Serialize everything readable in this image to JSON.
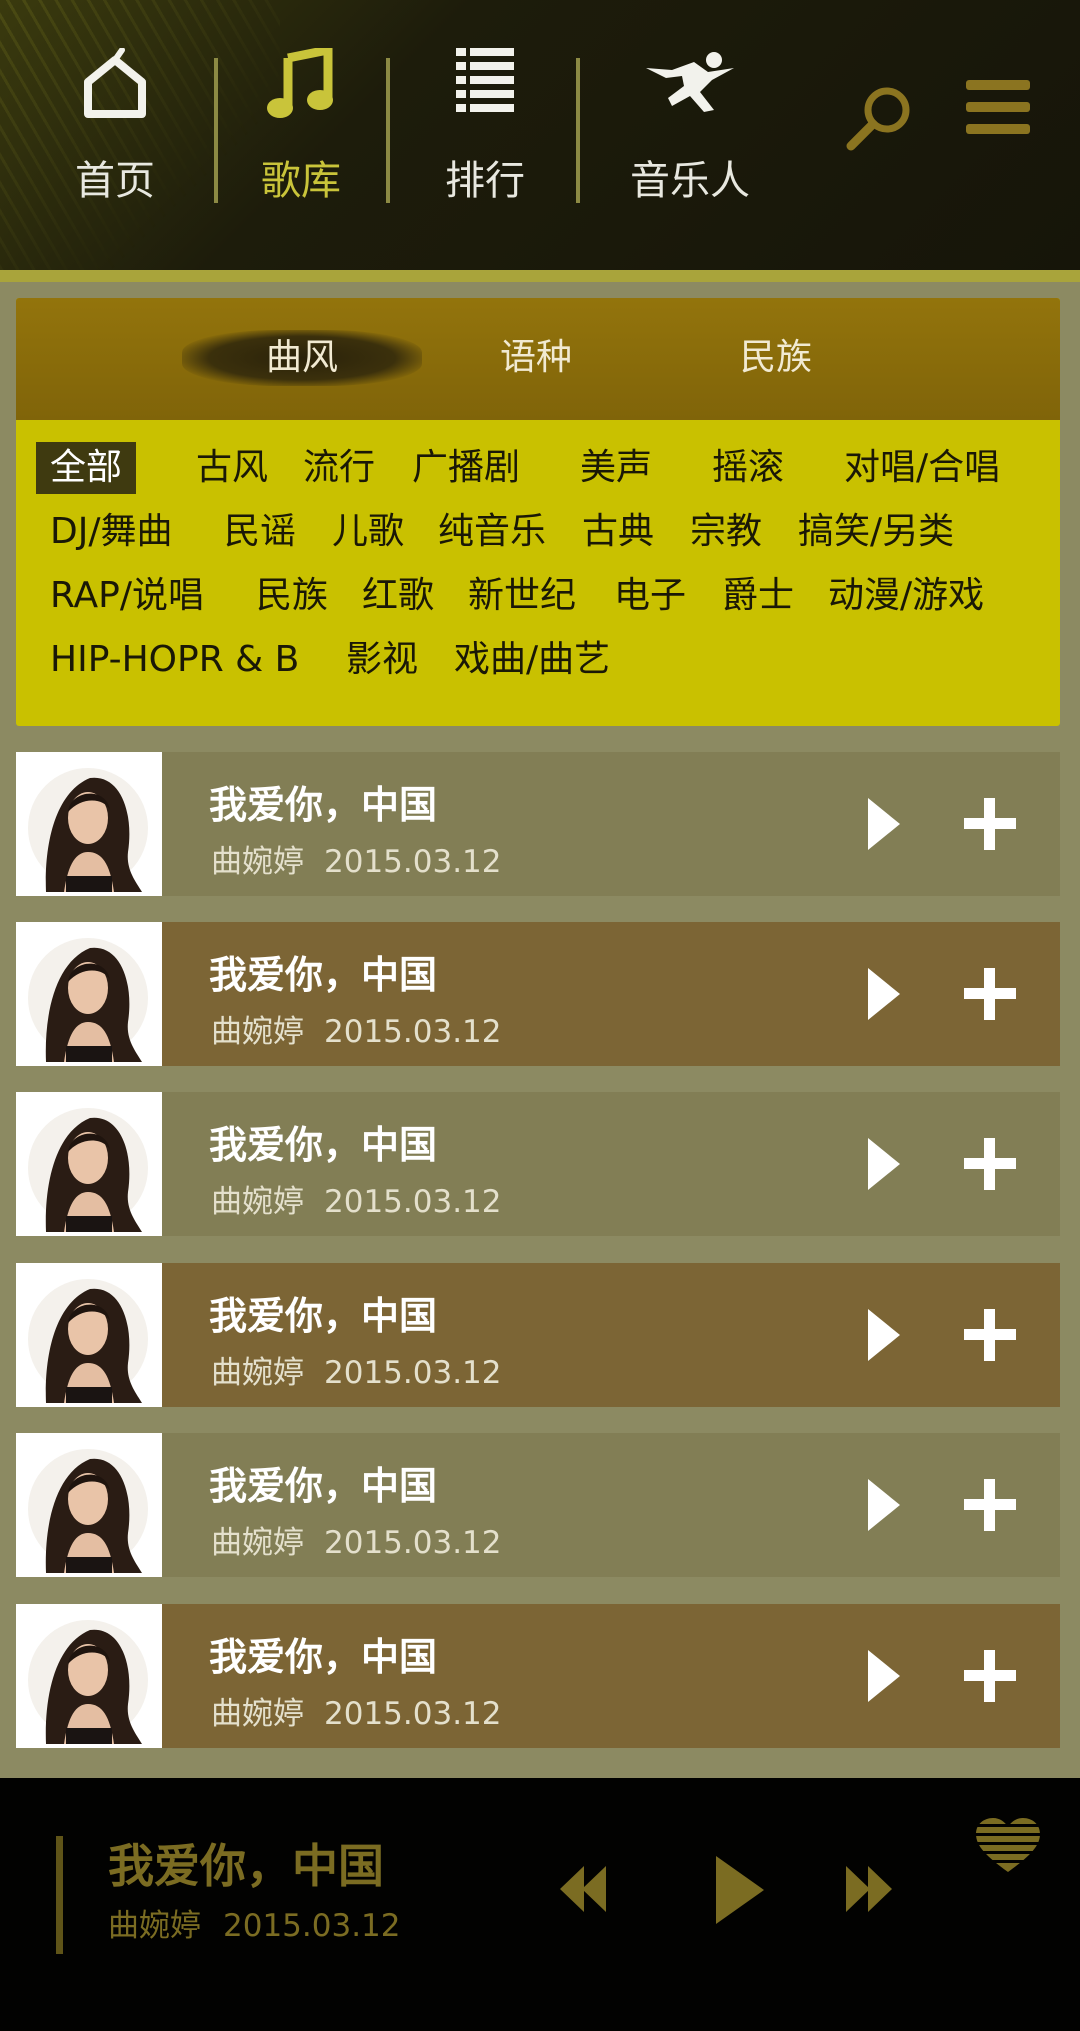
{
  "nav": {
    "items": [
      {
        "label": "首页",
        "icon": "home-icon"
      },
      {
        "label": "歌库",
        "icon": "music-note-icon",
        "active": true
      },
      {
        "label": "排行",
        "icon": "list-icon"
      },
      {
        "label": "音乐人",
        "icon": "musician-icon"
      }
    ],
    "search_icon": "search-icon",
    "menu_icon": "menu-icon"
  },
  "filter": {
    "tabs": [
      "曲风",
      "语种",
      "民族"
    ],
    "active_tab": "曲风",
    "genres": [
      "全部",
      "古风",
      "流行",
      "广播剧",
      "美声",
      "摇滚",
      "对唱/合唱",
      "DJ/舞曲",
      "民谣",
      "儿歌",
      "纯音乐",
      "古典",
      "宗教",
      "搞笑/另类",
      "RAP/说唱",
      "民族",
      "红歌",
      "新世纪",
      "电子",
      "爵士",
      "动漫/游戏",
      "HIP-HOPR & B",
      "影视",
      "戏曲/曲艺"
    ],
    "active_genre": "全部"
  },
  "songs": [
    {
      "title": "我爱你，中国",
      "artist": "曲婉婷",
      "date": "2015.03.12"
    },
    {
      "title": "我爱你，中国",
      "artist": "曲婉婷",
      "date": "2015.03.12"
    },
    {
      "title": "我爱你，中国",
      "artist": "曲婉婷",
      "date": "2015.03.12"
    },
    {
      "title": "我爱你，中国",
      "artist": "曲婉婷",
      "date": "2015.03.12"
    },
    {
      "title": "我爱你，中国",
      "artist": "曲婉婷",
      "date": "2015.03.12"
    },
    {
      "title": "我爱你，中国",
      "artist": "曲婉婷",
      "date": "2015.03.12"
    }
  ],
  "player": {
    "title": "我爱你，中国",
    "artist": "曲婉婷",
    "date": "2015.03.12"
  },
  "colors": {
    "accent": "#c9c43a",
    "panel": "#c9c100",
    "tab_bar": "#8a6d0b",
    "row_light": "#827e55",
    "row_dark": "#7c6535",
    "player_gold": "#7b6c22"
  }
}
